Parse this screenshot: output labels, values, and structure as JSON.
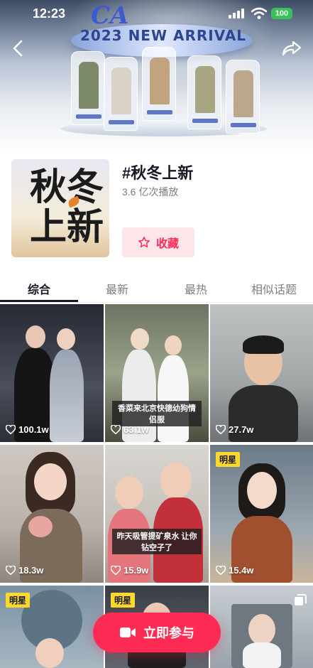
{
  "status_bar": {
    "time": "12:23",
    "battery": "100"
  },
  "banner": {
    "brand_text": "CA",
    "arrival_text": "2023 NEW ARRIVAL"
  },
  "topic": {
    "title": "#秋冬上新",
    "plays": "3.6 亿次播放",
    "cover_line1": "秋冬",
    "cover_line2": "上新",
    "favorite_label": "收藏"
  },
  "tabs": [
    "综合",
    "最新",
    "最热",
    "相似话题"
  ],
  "videos": [
    {
      "likes": "100.1w"
    },
    {
      "likes": "63.1w",
      "caption": "香菜来北京快德幼狗情侣服"
    },
    {
      "likes": "27.7w"
    },
    {
      "likes": "18.3w"
    },
    {
      "likes": "15.9w",
      "caption": "昨天吸管提矿泉水 让你钻空子了"
    },
    {
      "likes": "15.4w",
      "badge": "明星"
    },
    {
      "badge": "明星"
    },
    {
      "badge": "明星"
    },
    {}
  ],
  "join_button": {
    "label": "立即参与"
  },
  "colors": {
    "accent": "#fe2c55",
    "badge": "#ffd82b",
    "favorite_bg": "#fde6ea"
  }
}
